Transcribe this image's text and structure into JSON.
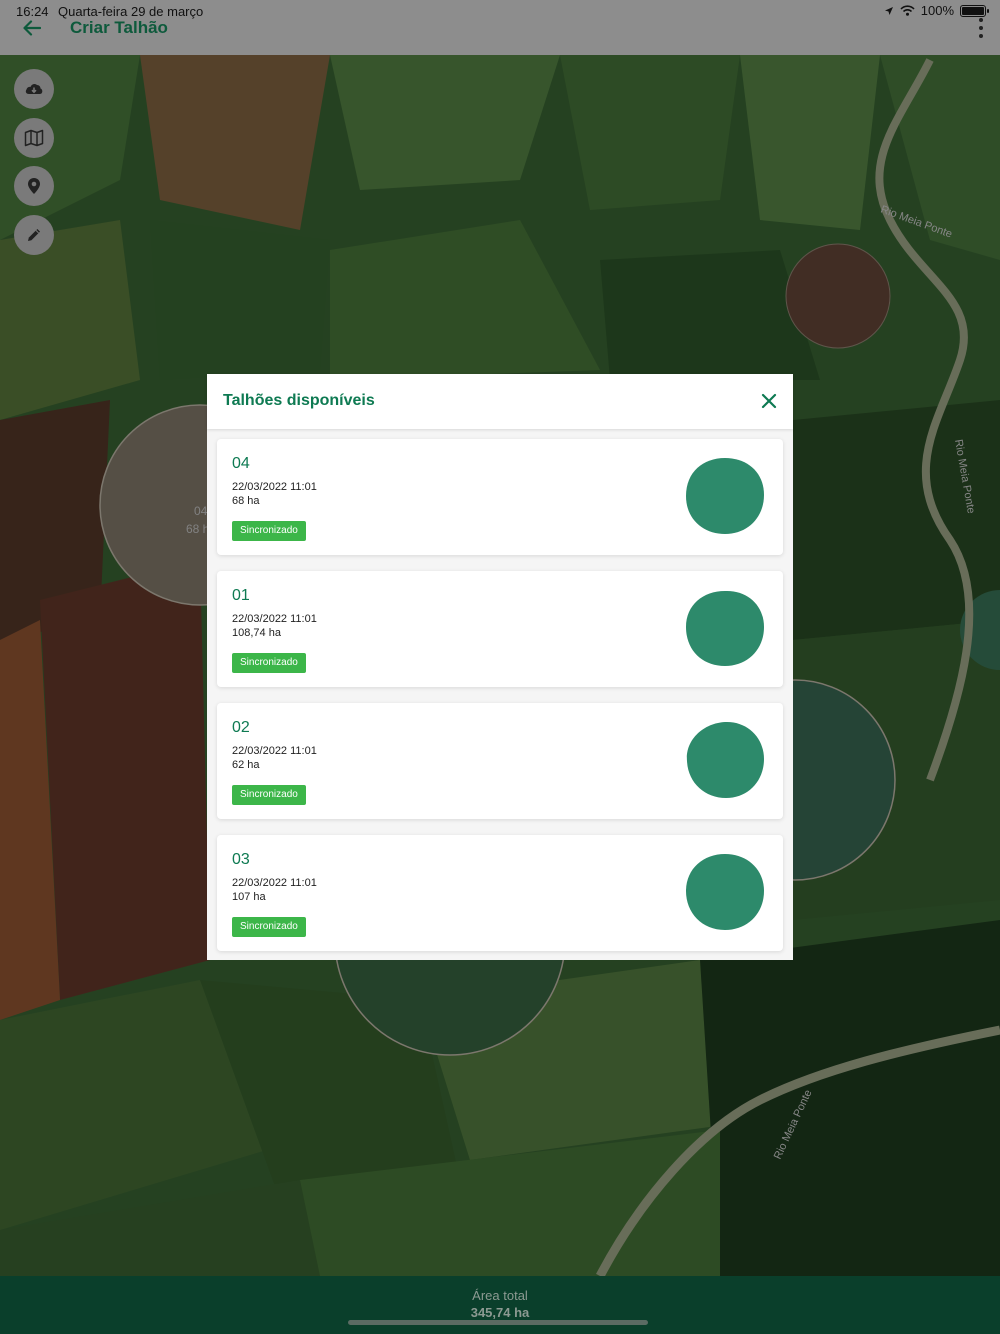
{
  "status_bar": {
    "time": "16:24",
    "date": "Quarta-feira 29 de março",
    "battery": "100%"
  },
  "header": {
    "title": "Criar Talhão"
  },
  "map": {
    "field_labels": [
      {
        "code": "04",
        "area": "68 h"
      }
    ],
    "river_labels": [
      "Rio Meia Ponte",
      "Rio Meia Ponte",
      "Rio Meia Ponte"
    ]
  },
  "modal": {
    "title": "Talhões disponíveis",
    "items": [
      {
        "name": "04",
        "date": "22/03/2022 11:01",
        "area": "68 ha",
        "status": "Sincronizado"
      },
      {
        "name": "01",
        "date": "22/03/2022 11:01",
        "area": "108,74 ha",
        "status": "Sincronizado"
      },
      {
        "name": "02",
        "date": "22/03/2022 11:01",
        "area": "62 ha",
        "status": "Sincronizado"
      },
      {
        "name": "03",
        "date": "22/03/2022 11:01",
        "area": "107 ha",
        "status": "Sincronizado"
      }
    ]
  },
  "footer": {
    "label": "Área total",
    "value": "345,74 ha"
  },
  "colors": {
    "brand_green": "#0e7a52",
    "badge_green": "#3cb649",
    "shape_green": "#2d8a6b",
    "footer_bg": "#0a3f2b"
  }
}
